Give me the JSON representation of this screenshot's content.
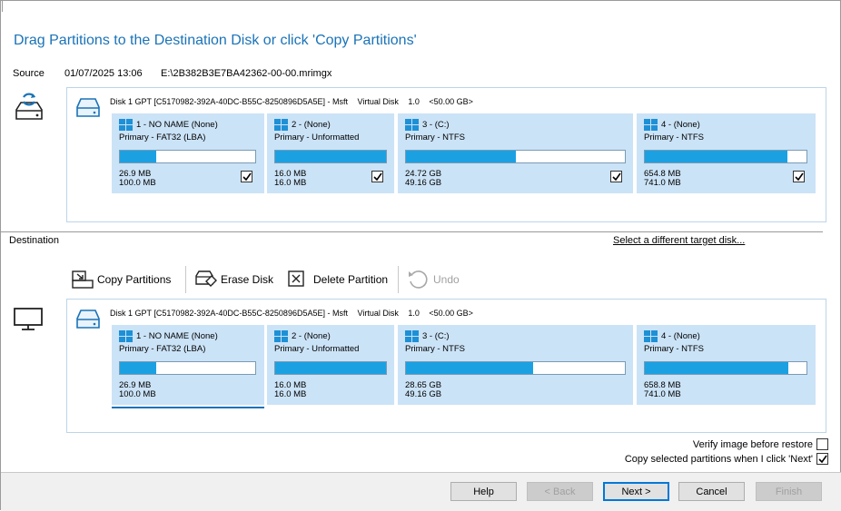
{
  "title": "Drag Partitions to the Destination Disk or click 'Copy Partitions'",
  "source": {
    "label": "Source",
    "date": "01/07/2025 13:06",
    "path": "E:\\2B382B3E7BA42362-00-00.mrimgx",
    "disk": {
      "name": "Disk 1 GPT [C5170982-392A-40DC-B55C-8250896D5A5E] - Msft",
      "kind": "Virtual Disk",
      "version": "1.0",
      "size": "<50.00 GB>",
      "checked": true,
      "partitions": [
        {
          "name": "1 - NO NAME (None)",
          "type": "Primary - FAT32 (LBA)",
          "used": "26.9 MB",
          "total": "100.0 MB",
          "fill": 0.27,
          "checked": true
        },
        {
          "name": "2 -  (None)",
          "type": "Primary - Unformatted",
          "used": "16.0 MB",
          "total": "16.0 MB",
          "fill": 1.0,
          "checked": true
        },
        {
          "name": "3 -  (C:)",
          "type": "Primary - NTFS",
          "used": "24.72 GB",
          "total": "49.16 GB",
          "fill": 0.5,
          "checked": true
        },
        {
          "name": "4 -  (None)",
          "type": "Primary - NTFS",
          "used": "654.8 MB",
          "total": "741.0 MB",
          "fill": 0.88,
          "checked": true
        }
      ]
    }
  },
  "destination": {
    "label": "Destination",
    "select_target": "Select a different target disk...",
    "toolbar": {
      "copy": "Copy Partitions",
      "erase": "Erase Disk",
      "delete": "Delete Partition",
      "undo": "Undo"
    },
    "disk": {
      "name": "Disk 1 GPT [C5170982-392A-40DC-B55C-8250896D5A5E] - Msft",
      "kind": "Virtual Disk",
      "version": "1.0",
      "size": "<50.00 GB>",
      "partitions": [
        {
          "name": "1 - NO NAME (None)",
          "type": "Primary - FAT32 (LBA)",
          "used": "26.9 MB",
          "total": "100.0 MB",
          "fill": 0.27
        },
        {
          "name": "2 -  (None)",
          "type": "Primary - Unformatted",
          "used": "16.0 MB",
          "total": "16.0 MB",
          "fill": 1.0
        },
        {
          "name": "3 -  (C:)",
          "type": "Primary - NTFS",
          "used": "28.65 GB",
          "total": "49.16 GB",
          "fill": 0.58
        },
        {
          "name": "4 -  (None)",
          "type": "Primary - NTFS",
          "used": "658.8 MB",
          "total": "741.0 MB",
          "fill": 0.89
        }
      ]
    }
  },
  "options": {
    "verify": {
      "label": "Verify image before restore",
      "checked": false
    },
    "copy_selected": {
      "label": "Copy selected partitions when I click 'Next'",
      "checked": true
    }
  },
  "buttons": {
    "help": "Help",
    "back": "< Back",
    "next": "Next >",
    "cancel": "Cancel",
    "finish": "Finish"
  },
  "colors": {
    "accent": "#1a73b8",
    "partition_bg": "#cbe3f7",
    "bar_fill": "#1ba1e2"
  }
}
